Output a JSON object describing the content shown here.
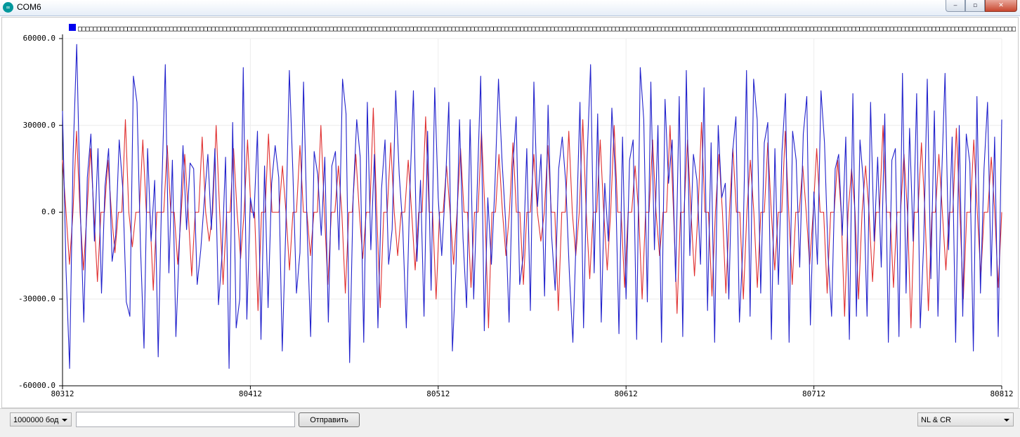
{
  "window": {
    "title": "COM6",
    "app_icon": "arduino-icon",
    "controls": [
      "minimize-icon",
      "maximize-icon",
      "close-icon"
    ]
  },
  "chart_data": {
    "type": "line",
    "ylim": [
      -60000,
      60000
    ],
    "yticks": [
      "60000.0",
      "30000.0",
      "0.0",
      "-30000.0",
      "-60000.0"
    ],
    "xlim": [
      80312,
      80812
    ],
    "xticks": [
      "80312",
      "80412",
      "80512",
      "80612",
      "80712",
      "80812"
    ],
    "grid": true,
    "legend_placement": "top",
    "series": [
      {
        "color": "#2222cc",
        "values": [
          35000,
          -20000,
          -54000,
          20000,
          58000,
          2000,
          -38000,
          12000,
          27000,
          -10000,
          22000,
          -28000,
          9000,
          22000,
          -17000,
          -8000,
          25000,
          8000,
          -31000,
          -36000,
          47000,
          38000,
          -12000,
          -47000,
          22000,
          -10000,
          11000,
          -50000,
          8000,
          51000,
          -21000,
          18000,
          -43000,
          -10000,
          23000,
          -6000,
          17000,
          15000,
          -25000,
          -13000,
          4000,
          20000,
          -6000,
          22000,
          -32000,
          -15000,
          19000,
          -54000,
          31000,
          -40000,
          -30000,
          50000,
          -37000,
          5000,
          -2000,
          28000,
          -44000,
          16000,
          -33000,
          10000,
          23000,
          12000,
          -48000,
          -5000,
          49000,
          14000,
          -28000,
          -14000,
          45000,
          -5000,
          -43000,
          21000,
          13000,
          -8000,
          19000,
          -38000,
          16000,
          21000,
          -13000,
          46000,
          34000,
          -52000,
          5000,
          32000,
          19000,
          -45000,
          38000,
          -13000,
          20000,
          -40000,
          8000,
          25000,
          -18000,
          -6000,
          42000,
          13000,
          -5000,
          -40000,
          7000,
          42000,
          -17000,
          11000,
          -36000,
          28000,
          -27000,
          43000,
          5000,
          -15000,
          8000,
          38000,
          -48000,
          -20000,
          32000,
          -9000,
          -33000,
          32000,
          -30000,
          8000,
          47000,
          -41000,
          5000,
          -18000,
          9000,
          46000,
          18000,
          -3000,
          -38000,
          15000,
          33000,
          -25000,
          -15000,
          22000,
          -34000,
          45000,
          2000,
          20000,
          -29000,
          37000,
          -8000,
          -27000,
          15000,
          26000,
          10000,
          -21000,
          -45000,
          -5000,
          38000,
          -40000,
          18000,
          51000,
          -21000,
          34000,
          -38000,
          10000,
          -10000,
          36000,
          12000,
          -42000,
          26000,
          -30000,
          18000,
          25000,
          -44000,
          50000,
          32000,
          -31000,
          45000,
          -13000,
          30000,
          -45000,
          39000,
          10000,
          25000,
          -24000,
          40000,
          -43000,
          49000,
          -15000,
          20000,
          11000,
          -18000,
          43000,
          -34000,
          24000,
          -45000,
          30000,
          5000,
          10000,
          -30000,
          20000,
          33000,
          -38000,
          -11000,
          49000,
          -36000,
          46000,
          32000,
          -28000,
          24000,
          31000,
          -44000,
          22000,
          -25000,
          21000,
          41000,
          -45000,
          28000,
          18000,
          -19000,
          27000,
          40000,
          -39000,
          7000,
          -18000,
          42000,
          24000,
          -15000,
          -36000,
          15000,
          20000,
          -8000,
          26000,
          -44000,
          41000,
          -36000,
          25000,
          10000,
          -36000,
          38000,
          -10000,
          19000,
          -19000,
          34000,
          -45000,
          18000,
          22000,
          -43000,
          48000,
          -28000,
          29000,
          -10000,
          41000,
          -40000,
          -10000,
          46000,
          -23000,
          35000,
          -36000,
          10000,
          48000,
          -13000,
          26000,
          -45000,
          30000,
          -36000,
          27000,
          17000,
          -48000,
          40000,
          -28000,
          15000,
          38000,
          -22000,
          26000,
          -43000,
          32000
        ]
      },
      {
        "color": "#e03030",
        "values": [
          18000,
          0,
          -18000,
          0,
          28000,
          0,
          -20000,
          0,
          22000,
          0,
          -24000,
          0,
          0,
          18000,
          0,
          -14000,
          0,
          0,
          32000,
          0,
          -12000,
          0,
          0,
          25000,
          0,
          0,
          -27000,
          0,
          0,
          0,
          23000,
          0,
          0,
          -18000,
          0,
          20000,
          0,
          -22000,
          0,
          0,
          26000,
          0,
          -10000,
          0,
          30000,
          0,
          -25000,
          0,
          0,
          22000,
          0,
          -16000,
          0,
          25000,
          0,
          0,
          -34000,
          0,
          0,
          27000,
          0,
          0,
          0,
          16000,
          0,
          -20000,
          0,
          0,
          23000,
          0,
          0,
          -15000,
          0,
          0,
          30000,
          0,
          -25000,
          0,
          0,
          16000,
          0,
          -28000,
          0,
          0,
          20000,
          0,
          -16000,
          0,
          0,
          36000,
          0,
          -33000,
          0,
          0,
          24000,
          0,
          -15000,
          0,
          0,
          18000,
          0,
          -20000,
          0,
          0,
          33000,
          0,
          0,
          -30000,
          0,
          0,
          16000,
          0,
          -18000,
          0,
          22000,
          0,
          0,
          -26000,
          0,
          0,
          28000,
          0,
          -40000,
          0,
          0,
          20000,
          0,
          -15000,
          0,
          24000,
          0,
          0,
          -25000,
          0,
          0,
          20000,
          0,
          -10000,
          0,
          23000,
          0,
          0,
          -34000,
          0,
          0,
          28000,
          0,
          -15000,
          0,
          32000,
          0,
          -23000,
          0,
          0,
          25000,
          0,
          -20000,
          0,
          30000,
          0,
          0,
          -26000,
          0,
          0,
          16000,
          0,
          -30000,
          0,
          0,
          25000,
          0,
          -15000,
          0,
          0,
          30000,
          0,
          -35000,
          0,
          0,
          25000,
          0,
          -22000,
          0,
          31000,
          0,
          0,
          -29000,
          0,
          20000,
          0,
          -28000,
          0,
          22000,
          0,
          0,
          -30000,
          0,
          18000,
          0,
          -26000,
          0,
          0,
          24000,
          0,
          -20000,
          0,
          0,
          28000,
          0,
          -25000,
          0,
          0,
          16000,
          0,
          -18000,
          0,
          22000,
          0,
          0,
          -28000,
          0,
          0,
          18000,
          0,
          -36000,
          0,
          15000,
          0,
          -30000,
          0,
          16000,
          0,
          -24000,
          0,
          0,
          30000,
          0,
          0,
          -26000,
          0,
          0,
          20000,
          0,
          -40000,
          0,
          0,
          24000,
          0,
          -34000,
          0,
          0,
          20000,
          0,
          -20000,
          0,
          0,
          29000,
          0,
          -30000,
          0,
          0,
          25000,
          0,
          -22000,
          0,
          0,
          19000,
          0,
          -26000,
          0
        ]
      }
    ]
  },
  "legend": {
    "marker_color": "#0000ee",
    "label": "□□□□□□□□□□□□□□□□□□□□□□□□□□□□□□□□□□□□□□□□□□□□□□□□□□□□□□□□□□□□□□□□□□□□□□□□□□□□□□□□□□□□□□□□□□□□□□□□□□□□□□□□□□□□□□□□□□□□□□□□□□□□□□□□□□□□□□□□□□□□□□□□□□□□□□□□□□□□□□□□□□□□□□□□□□□□□□□□□□□□□□□□□□□□□□□□□□□□□□□□□□□□□□□□□□□□□□□□□□□□□□□□□□□□□□□□□□□□□□□□□□□□□□"
  },
  "controls": {
    "baud": "1000000 бод",
    "input_value": "",
    "send_label": "Отправить",
    "line_ending": "NL & CR"
  }
}
